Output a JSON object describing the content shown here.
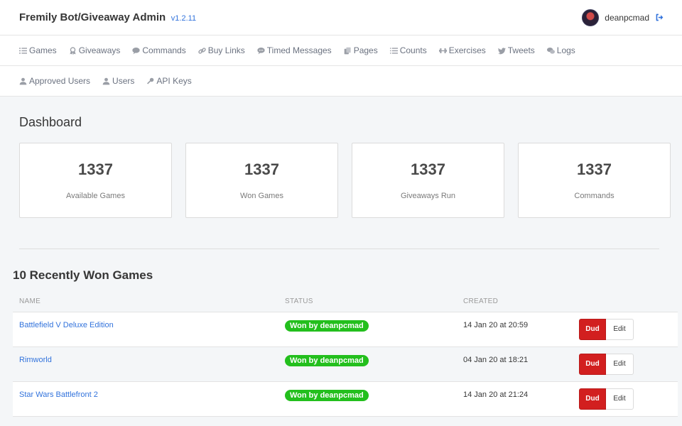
{
  "header": {
    "title": "Fremily Bot/Giveaway Admin",
    "version": "v1.2.11",
    "username": "deanpcmad"
  },
  "nav": {
    "row1": [
      {
        "label": "Games",
        "icon": "list-icon"
      },
      {
        "label": "Giveaways",
        "icon": "award-icon"
      },
      {
        "label": "Commands",
        "icon": "comment-icon"
      },
      {
        "label": "Buy Links",
        "icon": "link-icon"
      },
      {
        "label": "Timed Messages",
        "icon": "comment-dots-icon"
      },
      {
        "label": "Pages",
        "icon": "copy-icon"
      },
      {
        "label": "Counts",
        "icon": "list-ol-icon"
      },
      {
        "label": "Exercises",
        "icon": "dumbbell-icon"
      },
      {
        "label": "Tweets",
        "icon": "twitter-icon"
      },
      {
        "label": "Logs",
        "icon": "comments-icon"
      }
    ],
    "row2": [
      {
        "label": "Approved Users",
        "icon": "user-icon"
      },
      {
        "label": "Users",
        "icon": "user-icon"
      },
      {
        "label": "API Keys",
        "icon": "key-icon"
      }
    ]
  },
  "dashboard": {
    "title": "Dashboard",
    "stats": [
      {
        "value": "1337",
        "label": "Available Games"
      },
      {
        "value": "1337",
        "label": "Won Games"
      },
      {
        "value": "1337",
        "label": "Giveaways Run"
      },
      {
        "value": "1337",
        "label": "Commands"
      }
    ]
  },
  "recent": {
    "title": "10 Recently Won Games",
    "columns": [
      "NAME",
      "STATUS",
      "CREATED",
      ""
    ],
    "rows": [
      {
        "name": "Battlefield V Deluxe Edition",
        "status": "Won by deanpcmad",
        "created": "14 Jan 20 at 20:59"
      },
      {
        "name": "Rimworld",
        "status": "Won by deanpcmad",
        "created": "04 Jan 20 at 18:21"
      },
      {
        "name": "Star Wars Battlefront 2",
        "status": "Won by deanpcmad",
        "created": "14 Jan 20 at 21:24"
      }
    ],
    "dud_label": "Dud",
    "edit_label": "Edit"
  },
  "colors": {
    "accent": "#3273dc",
    "success": "#23bf1d",
    "danger": "#d21f1f"
  }
}
